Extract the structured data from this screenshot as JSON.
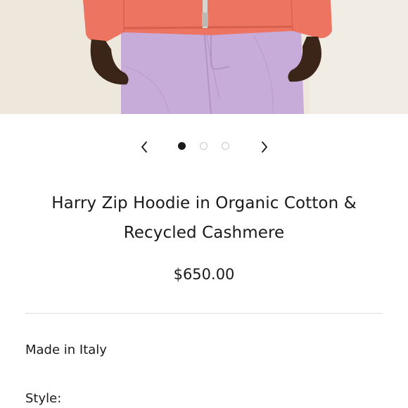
{
  "product": {
    "title": "Harry Zip Hoodie in Organic Cotton & Recycled Cashmere",
    "price": "$650.00",
    "origin": "Made in Italy",
    "style_label": "Style:"
  },
  "carousel": {
    "total_images": 3,
    "active_index": 0,
    "prev_icon": "chevron-left-icon",
    "next_icon": "chevron-right-icon"
  },
  "colors": {
    "hoodie": "#ec7461",
    "pants": "#c9aedb",
    "background": "#efe9df",
    "active_dot": "#1a1a1a"
  }
}
